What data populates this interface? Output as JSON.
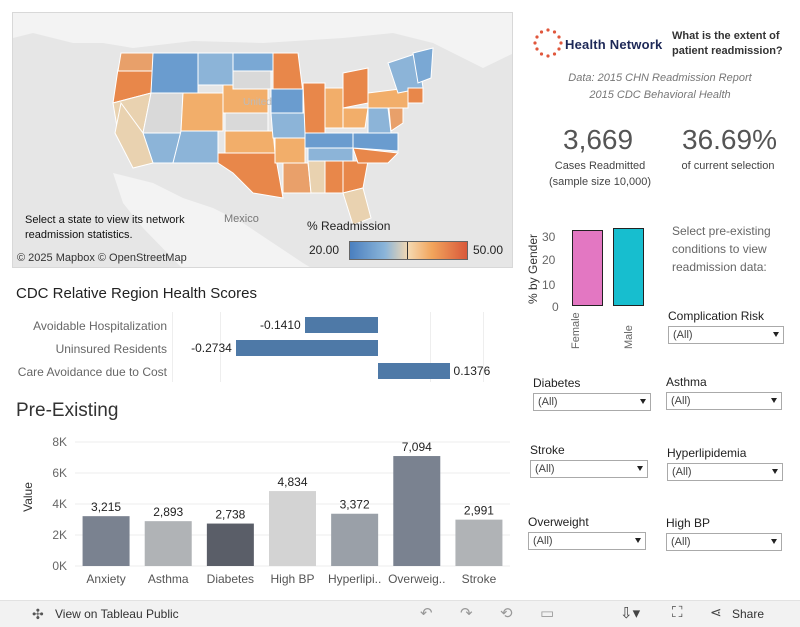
{
  "map": {
    "instruction": "Select a state to view its network readmission statistics.",
    "credit": "© 2025 Mapbox  © OpenStreetMap",
    "mexico_label": "Mexico",
    "legend_title": "% Readmission",
    "legend_min": "20.00",
    "legend_max": "50.00",
    "colors": {
      "low": "#4a7fbf",
      "mid": "#f5d8b0",
      "high": "#d9583a"
    }
  },
  "header": {
    "logo_text": "Health Network",
    "question": "What is the extent of patient readmission?",
    "source_line1": "Data: 2015 CHN Readmission Report",
    "source_line2": "2015 CDC Behavioral Health"
  },
  "kpis": {
    "cases_value": "3,669",
    "cases_label": "Cases Readmitted",
    "cases_sub": "(sample size 10,000)",
    "pct_value": "36.69%",
    "pct_label": "of current selection"
  },
  "gender_chart": {
    "ylabel": "% by Gender",
    "ticks": [
      "30",
      "20",
      "10",
      "0"
    ],
    "categories": [
      "Female",
      "Male"
    ],
    "values": [
      36,
      37
    ],
    "colors": [
      "#e377c2",
      "#17becf"
    ]
  },
  "region_chart": {
    "title": "CDC Relative Region Health Scores",
    "rows": [
      {
        "label": "Avoidable Hospitalization",
        "value": -0.141,
        "text": "-0.1410"
      },
      {
        "label": "Uninsured Residents",
        "value": -0.2734,
        "text": "-0.2734"
      },
      {
        "label": "Care Avoidance due to Cost",
        "value": 0.1376,
        "text": "0.1376"
      }
    ],
    "color": "#4e79a7"
  },
  "filters": {
    "instruction": "Select pre-existing conditions to view readmission data:",
    "complication": {
      "label": "Complication Risk",
      "value": "(All)"
    },
    "diabetes": {
      "label": "Diabetes",
      "value": "(All)"
    },
    "asthma": {
      "label": "Asthma",
      "value": "(All)"
    },
    "stroke": {
      "label": "Stroke",
      "value": "(All)"
    },
    "hyperlipidemia": {
      "label": "Hyperlipidemia",
      "value": "(All)"
    },
    "overweight": {
      "label": "Overweight",
      "value": "(All)"
    },
    "highbp": {
      "label": "High BP",
      "value": "(All)"
    }
  },
  "chart_data": {
    "type": "bar",
    "title": "Pre-Existing",
    "ylabel": "Value",
    "xlabel": "",
    "ylim": [
      0,
      8000
    ],
    "yticks": [
      "8K",
      "6K",
      "4K",
      "2K",
      "0K"
    ],
    "categories": [
      "Anxiety",
      "Asthma",
      "Diabetes",
      "High BP",
      "Hyperlipi..",
      "Overweig..",
      "Stroke"
    ],
    "values": [
      3215,
      2893,
      2738,
      4834,
      3372,
      7094,
      2991
    ],
    "value_labels": [
      "3,215",
      "2,893",
      "2,738",
      "4,834",
      "3,372",
      "7,094",
      "2,991"
    ],
    "colors": [
      "#7a8290",
      "#b0b3b6",
      "#5a5e68",
      "#d3d3d3",
      "#9aa0a8",
      "#7a8290",
      "#b0b3b6"
    ],
    "grid": true
  },
  "footer": {
    "view_label": "View on Tableau Public",
    "share_label": "Share"
  }
}
